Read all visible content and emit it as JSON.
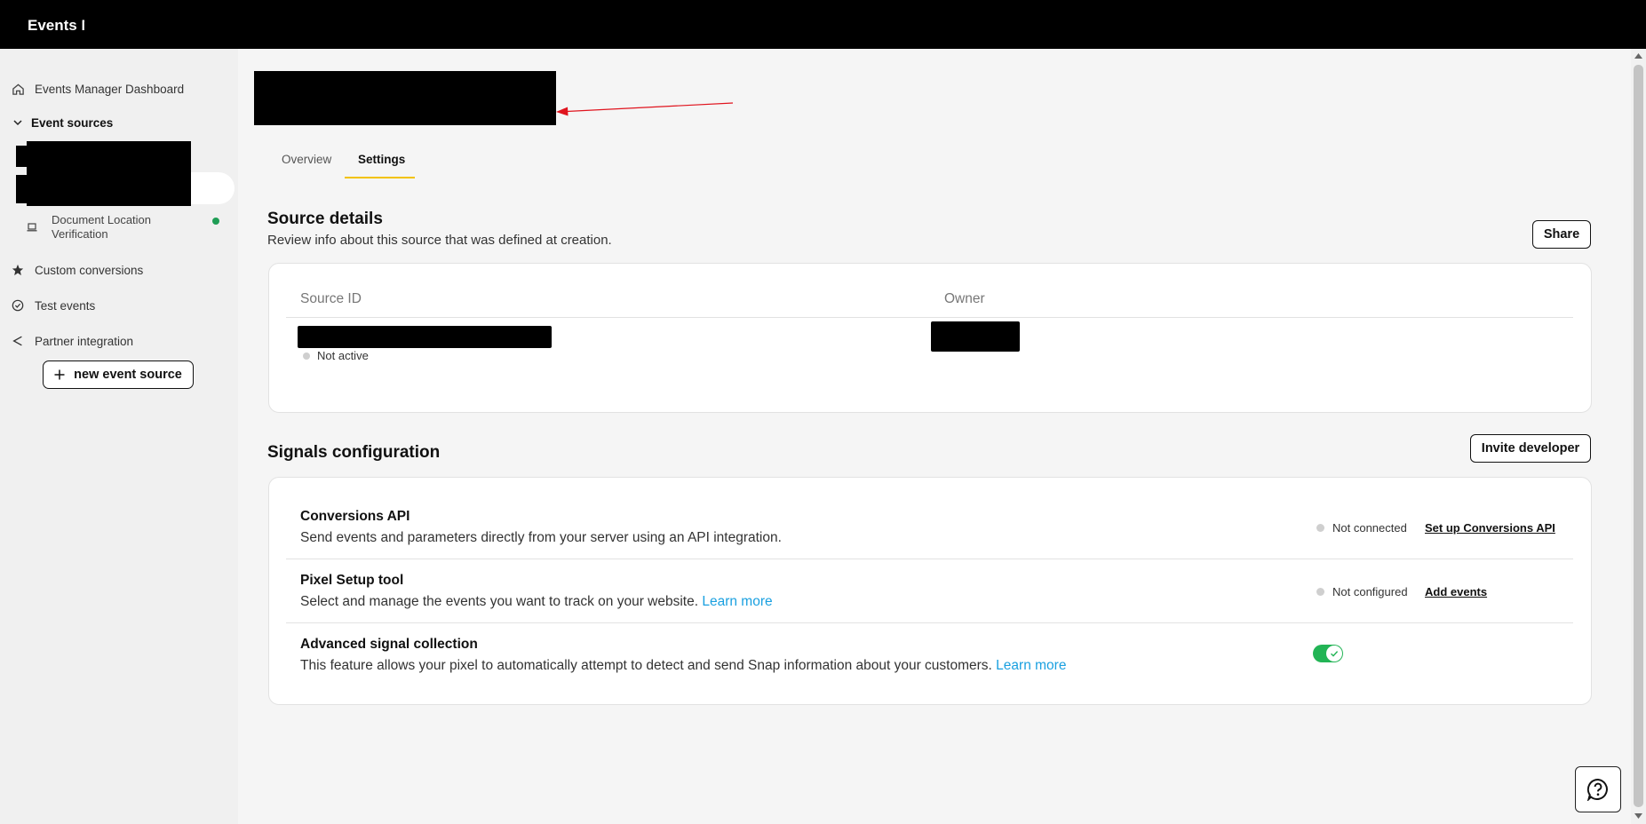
{
  "app": {
    "title": "Events Ma"
  },
  "sidebar": {
    "dashboard_label": "Events Manager Dashboard",
    "event_sources_label": "Event sources",
    "sub_source_label_line1": "Document Location",
    "sub_source_label_line2": "Verification",
    "custom_conversions_label": "Custom conversions",
    "test_events_label": "Test events",
    "partner_integration_label": "Partner integration",
    "new_event_source_label": "new event source"
  },
  "tabs": {
    "overview": "Overview",
    "settings": "Settings"
  },
  "source_details": {
    "title": "Source details",
    "subtitle": "Review info about this source that was defined at creation.",
    "share_label": "Share",
    "col_source_id": "Source ID",
    "col_owner": "Owner",
    "status": "Not active"
  },
  "signals": {
    "title": "Signals configuration",
    "invite_label": "Invite developer",
    "rows": [
      {
        "title": "Conversions API",
        "desc": "Send events and parameters directly from your server using an API integration.",
        "status": "Not connected",
        "action": "Set up Conversions API"
      },
      {
        "title": "Pixel Setup tool",
        "desc": "Select and manage the events you want to track on your website.",
        "link": "Learn more",
        "status": "Not configured",
        "action": "Add events"
      },
      {
        "title": "Advanced signal collection",
        "desc": "This feature allows your pixel to automatically attempt to detect and send Snap information about your customers.",
        "link": "Learn more",
        "enabled": true
      }
    ]
  },
  "colors": {
    "accent": "#f2c200",
    "toggle_on": "#22b455",
    "link": "#1aa0e0",
    "active_dot": "#1f9d55",
    "annotation_arrow": "#e0141e"
  },
  "icons": [
    "home-icon",
    "chevron-down-icon",
    "laptop-icon",
    "star-icon",
    "check-circle-icon",
    "share-icon",
    "plus-icon",
    "help-icon",
    "check-icon"
  ]
}
